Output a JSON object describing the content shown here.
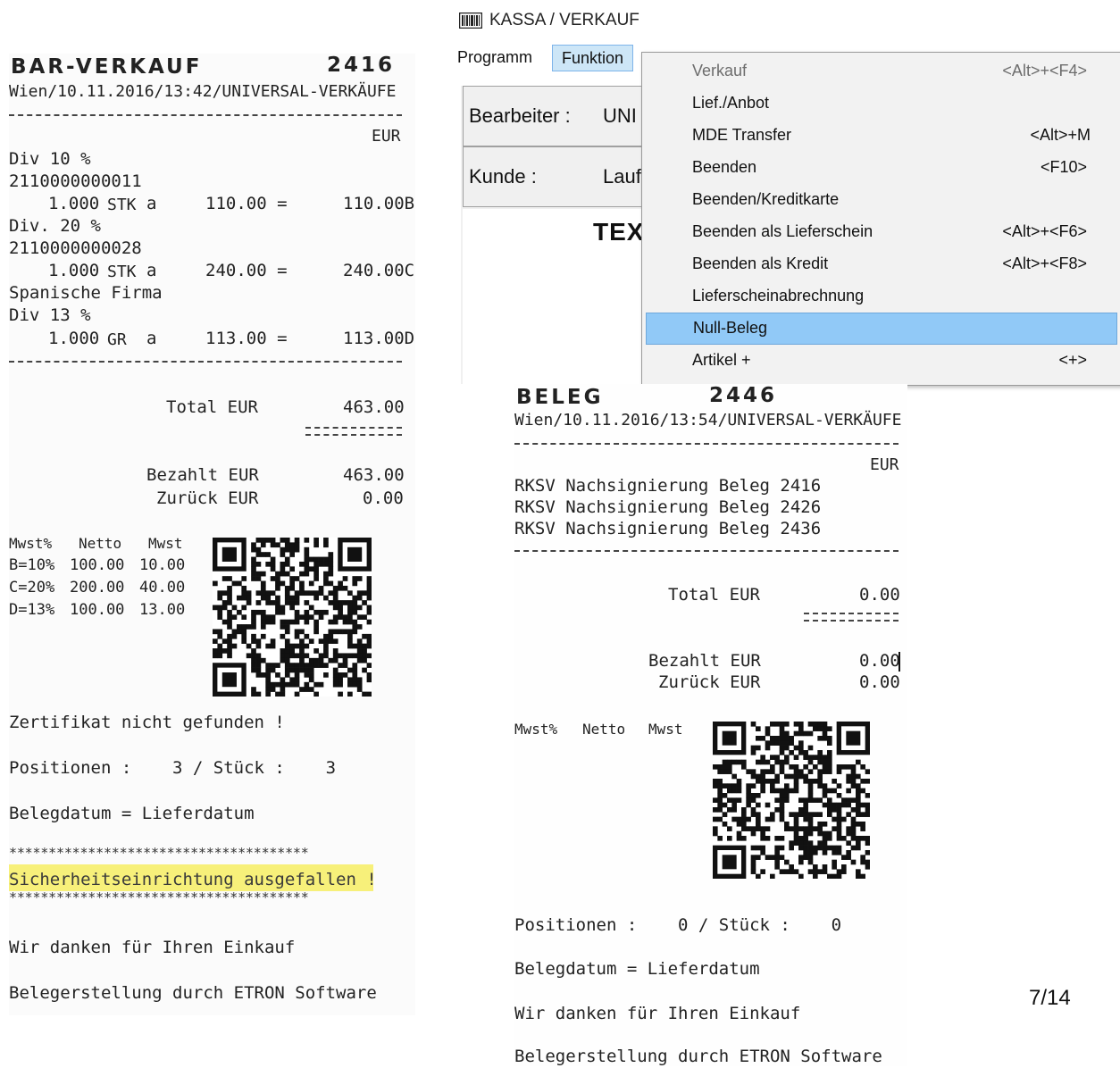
{
  "receipt1": {
    "title": "BAR-VERKAUF",
    "number": "2416",
    "subheader": "Wien/10.11.2016/13:42/UNIVERSAL-VERKÄUFE",
    "currency": "EUR",
    "lines": [
      {
        "text": "Div 10 %"
      },
      {
        "text": "2110000000011"
      },
      {
        "qty": "1.000",
        "unit": "STK",
        "a": "a",
        "price": "110.00 =",
        "amount": "110.00B"
      },
      {
        "text": "Div. 20 %"
      },
      {
        "text": "2110000000028"
      },
      {
        "qty": "1.000",
        "unit": "STK",
        "a": "a",
        "price": "240.00 =",
        "amount": "240.00C"
      },
      {
        "text": "Spanische Firma"
      },
      {
        "text": "Div 13 %"
      },
      {
        "qty": "1.000",
        "unit": "GR",
        "a": "a",
        "price": "113.00 =",
        "amount": "113.00D"
      }
    ],
    "total_label": "Total EUR",
    "total": "463.00",
    "paid_label": "Bezahlt EUR",
    "paid": "463.00",
    "change_label": "Zurück EUR",
    "change": "0.00",
    "vat_header": [
      "Mwst%",
      "Netto",
      "Mwst"
    ],
    "vat_rows": [
      [
        "B=10%",
        "100.00",
        "10.00"
      ],
      [
        "C=20%",
        "200.00",
        "40.00"
      ],
      [
        "D=13%",
        "100.00",
        "13.00"
      ]
    ],
    "cert_msg": "Zertifikat nicht gefunden !",
    "positions": "Positionen :    3 / Stück :    3",
    "belegdatum": "Belegdatum = Lieferdatum",
    "stars": "**************************************",
    "security_msg": "Sicherheitseinrichtung ausgefallen !",
    "thanks": "Wir danken für Ihren Einkauf",
    "footer": "Belegerstellung durch ETRON Software",
    "highlight_color": "#f7f07a"
  },
  "app": {
    "title": "KASSA / VERKAUF",
    "icon": "barcode-icon",
    "menu": {
      "programm": "Programm",
      "funktion": "Funktion"
    },
    "bearbeiter_label": "Bearbeiter :",
    "bearbeiter_value": "UNI",
    "kunde_label": "Kunde :",
    "kunde_value": "Lauf",
    "text_label": "TEXT",
    "dropdown": [
      {
        "label": "Verkauf",
        "shortcut": "<Alt>+<F4>",
        "state": "disabled"
      },
      {
        "label": "Lief./Anbot",
        "shortcut": "",
        "state": "normal"
      },
      {
        "label": "MDE Transfer",
        "shortcut": "<Alt>+M",
        "state": "normal"
      },
      {
        "label": "Beenden",
        "shortcut": "<F10>",
        "state": "normal"
      },
      {
        "label": "Beenden/Kreditkarte",
        "shortcut": "",
        "state": "normal"
      },
      {
        "label": "Beenden als Lieferschein",
        "shortcut": "<Alt>+<F6>",
        "state": "normal"
      },
      {
        "label": "Beenden als Kredit",
        "shortcut": "<Alt>+<F8>",
        "state": "normal"
      },
      {
        "label": "Lieferscheinabrechnung",
        "shortcut": "",
        "state": "normal"
      },
      {
        "label": "Null-Beleg",
        "shortcut": "",
        "state": "selected"
      },
      {
        "label": "Artikel +",
        "shortcut": "<+>",
        "state": "normal"
      }
    ],
    "selected_color": "#91c9f7"
  },
  "receipt2": {
    "title": "BELEG",
    "number": "2446",
    "subheader": "Wien/10.11.2016/13:54/UNIVERSAL-VERKÄUFE",
    "currency": "EUR",
    "lines": [
      "RKSV Nachsignierung Beleg 2416",
      "RKSV Nachsignierung Beleg 2426",
      "RKSV Nachsignierung Beleg 2436"
    ],
    "total_label": "Total EUR",
    "total": "0.00",
    "paid_label": "Bezahlt EUR",
    "paid": "0.00",
    "change_label": "Zurück EUR",
    "change": "0.00",
    "vat_header": [
      "Mwst%",
      "Netto",
      "Mwst"
    ],
    "positions": "Positionen :    0 / Stück :    0",
    "belegdatum": "Belegdatum = Lieferdatum",
    "thanks": "Wir danken für Ihren Einkauf",
    "footer": "Belegerstellung durch ETRON Software"
  },
  "page_number": "7/14"
}
